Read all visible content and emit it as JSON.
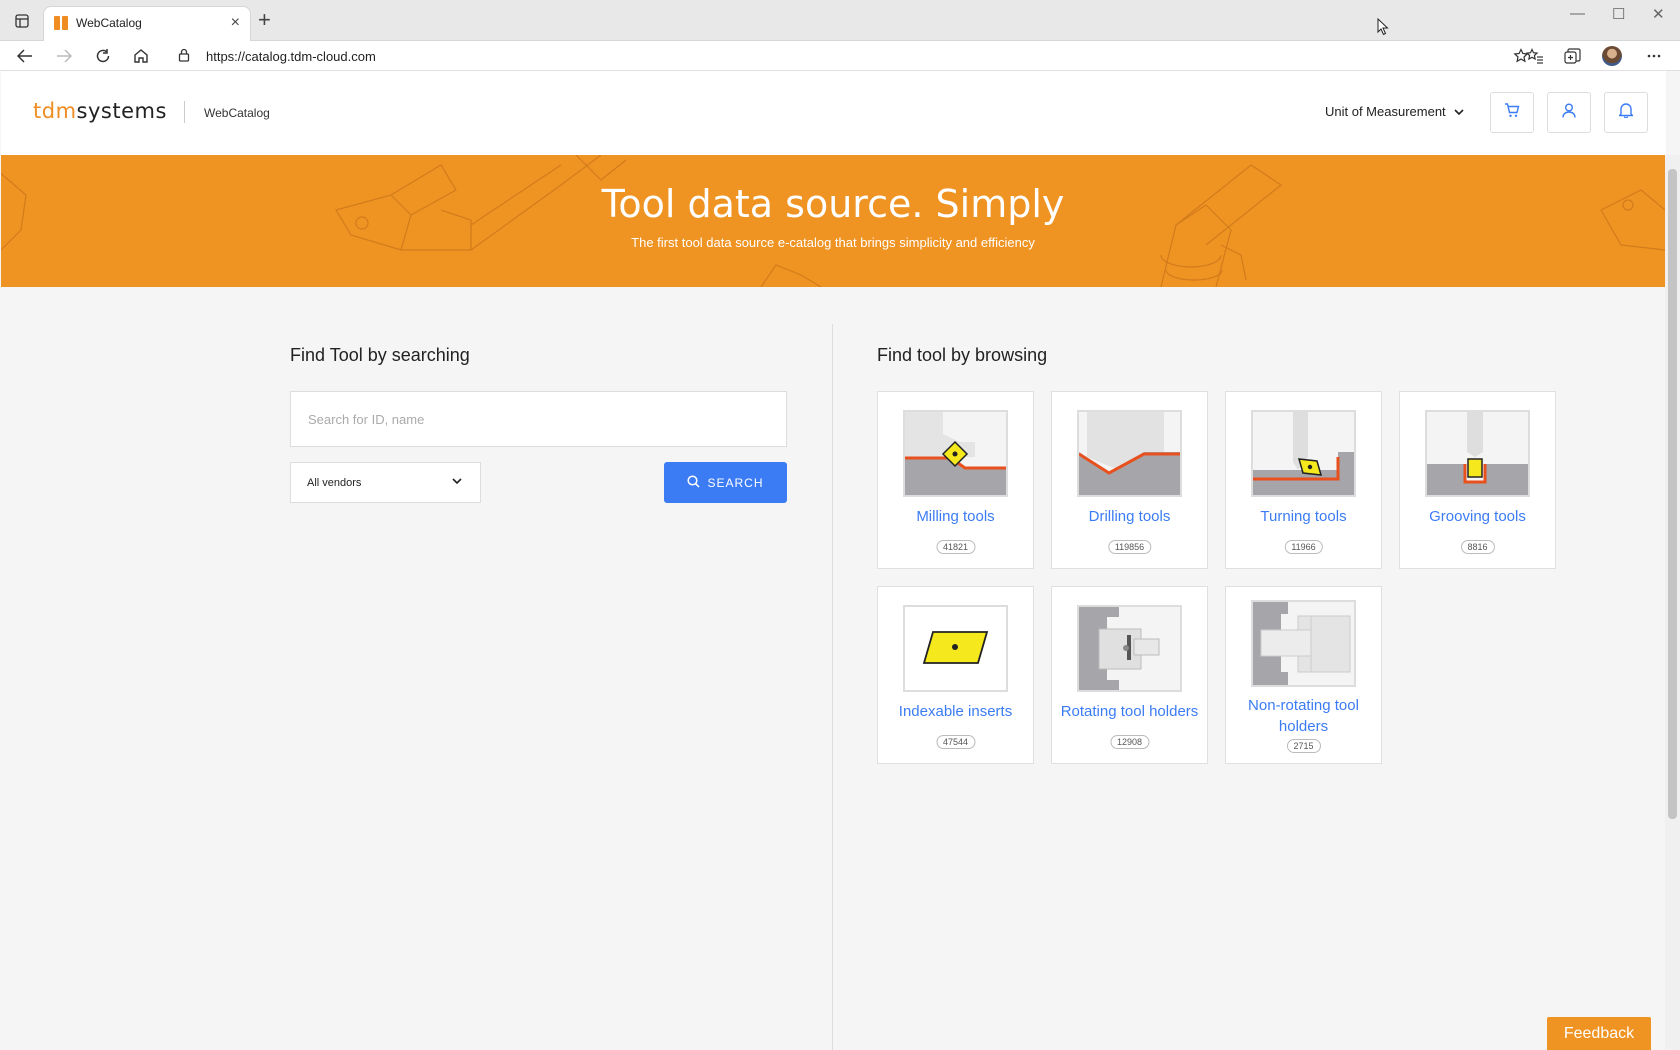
{
  "browser": {
    "tab_title": "WebCatalog",
    "url": "https://catalog.tdm-cloud.com"
  },
  "header": {
    "logo_tdm": "tdm",
    "logo_systems": "systems",
    "subtitle": "WebCatalog",
    "uom_label": "Unit of Measurement"
  },
  "banner": {
    "title": "Tool data source. Simply",
    "subtitle": "The first tool data source e-catalog that brings simplicity and efficiency"
  },
  "search_section": {
    "title": "Find Tool by searching",
    "placeholder": "Search for ID, name",
    "vendor_selected": "All vendors",
    "button_label": "SEARCH"
  },
  "browse_section": {
    "title": "Find tool by browsing",
    "categories": [
      {
        "label": "Milling tools",
        "count": "41821"
      },
      {
        "label": "Drilling tools",
        "count": "119856"
      },
      {
        "label": "Turning tools",
        "count": "11966"
      },
      {
        "label": "Grooving tools",
        "count": "8816"
      },
      {
        "label": "Indexable inserts",
        "count": "47544"
      },
      {
        "label": "Rotating tool holders",
        "count": "12908"
      },
      {
        "label": "Non-rotating tool holders",
        "count": "2715"
      }
    ]
  },
  "feedback_label": "Feedback",
  "colors": {
    "brand_orange": "#ef9322",
    "accent_blue": "#3b7cf4",
    "insert_yellow": "#f5e81c",
    "cut_red": "#e8501e"
  }
}
